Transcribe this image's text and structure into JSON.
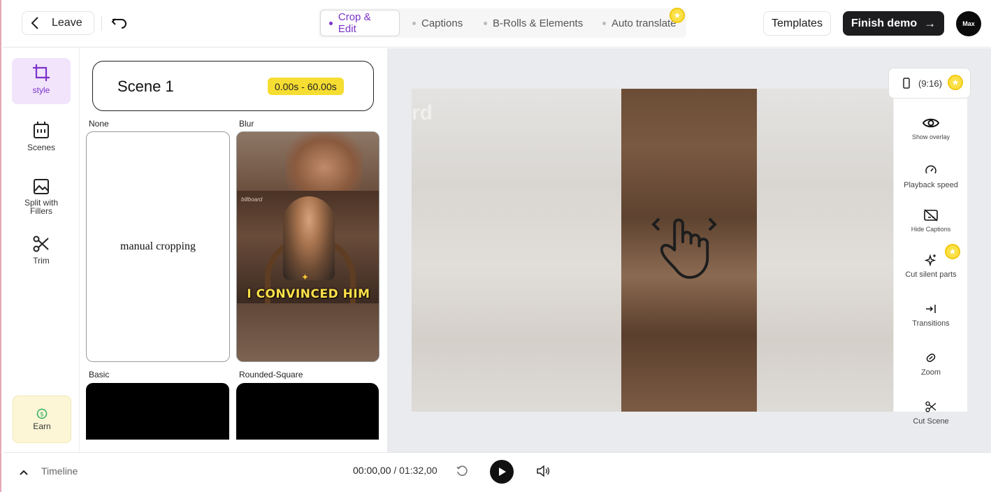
{
  "header": {
    "leave_label": "Leave",
    "tabs": [
      {
        "label": "Crop & Edit",
        "active": true
      },
      {
        "label": "Captions",
        "active": false
      },
      {
        "label": "B-Rolls & Elements",
        "active": false
      },
      {
        "label": "Auto translate",
        "active": false,
        "premium": true
      }
    ],
    "templates_label": "Templates",
    "finish_label": "Finish demo",
    "avatar_text": "Max"
  },
  "sidebar": {
    "items": [
      {
        "label": "style",
        "icon": "crop-icon",
        "active": true
      },
      {
        "label": "Scenes",
        "icon": "scenes-icon",
        "active": false
      },
      {
        "label": "Split with Fillers",
        "icon": "image-icon",
        "active": false
      },
      {
        "label": "Trim",
        "icon": "scissors-icon",
        "active": false
      }
    ],
    "earn_label": "Earn"
  },
  "style_panel": {
    "scene_title": "Scene 1",
    "scene_time": "0.00s - 60.00s",
    "options": [
      {
        "label": "None",
        "content": "manual cropping"
      },
      {
        "label": "Blur",
        "caption": "I CONVINCED HIM",
        "logo": "billboard"
      },
      {
        "label": "Basic"
      },
      {
        "label": "Rounded-Square"
      }
    ]
  },
  "preview": {
    "ghost_text": "rd",
    "aspect_label": "(9:16)",
    "tools": [
      {
        "label": "Show overlay",
        "icon": "eye-icon"
      },
      {
        "label": "Playback speed",
        "icon": "speedometer-icon"
      },
      {
        "label": "Hide Captions",
        "icon": "captions-off-icon"
      },
      {
        "label": "Cut silent parts",
        "icon": "sparkle-icon",
        "premium": true
      },
      {
        "label": "Transitions",
        "icon": "transition-icon"
      },
      {
        "label": "Zoom",
        "icon": "zoom-icon"
      },
      {
        "label": "Cut Scene",
        "icon": "scissors-icon"
      }
    ]
  },
  "timeline": {
    "label": "Timeline",
    "current_time": "00:00,00",
    "separator": "/",
    "total_time": "01:32,00"
  },
  "colors": {
    "accent": "#7b32c9",
    "premium": "#fbe046",
    "finish_bg": "#1d1d1f",
    "scene_time_bg": "#f6dd32"
  }
}
